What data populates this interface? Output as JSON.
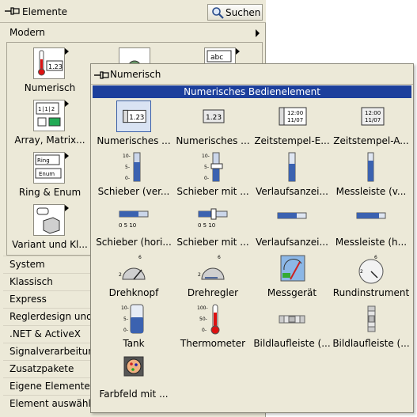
{
  "main": {
    "title": "Elemente",
    "search_label": "Suchen",
    "modern_label": "Modern",
    "tiles": [
      {
        "label": "Numerisch"
      },
      {
        "label": "Array, Matrix..."
      },
      {
        "label": "Ring & Enum"
      },
      {
        "label": "Variant und Kl..."
      }
    ],
    "categories": [
      "System",
      "Klassisch",
      "Express",
      "Reglerdesign und",
      ".NET & ActiveX",
      "Signalverarbeitun",
      "Zusatzpakete",
      "Eigene Elemente",
      "Element auswähl"
    ]
  },
  "sub": {
    "title": "Numerisch",
    "header": "Numerisches Bedienelement",
    "items": [
      "Numerisches ...",
      "Numerisches ...",
      "Zeitstempel-E...",
      "Zeitstempel-A...",
      "Schieber (ver...",
      "Schieber mit ...",
      "Verlaufsanzei...",
      "Messleiste (v...",
      "Schieber (hori...",
      "Schieber mit ...",
      "Verlaufsanzei...",
      "Messleiste (h...",
      "Drehknopf",
      "Drehregler",
      "Messgerät",
      "Rundinstrument",
      "Tank",
      "Thermometer",
      "Bildlaufleiste (...",
      "Bildlaufleiste (...",
      "Farbfeld mit ..."
    ],
    "icon_texts": {
      "numeric": "1.23",
      "time_top": "12:00",
      "time_bottom": "11/07",
      "ring": "Ring",
      "enum": "Enum",
      "abc": "abc"
    }
  }
}
